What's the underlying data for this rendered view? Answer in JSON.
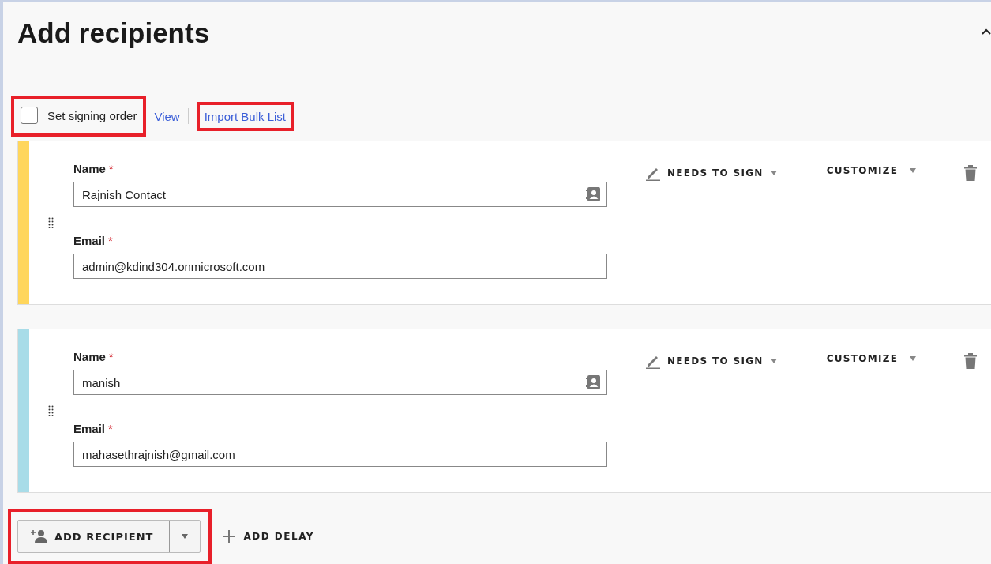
{
  "title": "Add recipients",
  "toolbar": {
    "signing_order": {
      "label": "Set signing order",
      "checked": false,
      "highlighted": true
    },
    "view_link": "View",
    "import_link": {
      "label": "Import Bulk List",
      "highlighted": true
    }
  },
  "recipients": [
    {
      "color": "#ffd65c",
      "name_label": "Name",
      "email_label": "Email",
      "required_mark": "*",
      "name": "Rajnish Contact",
      "email": "admin@kdind304.onmicrosoft.com",
      "role": "NEEDS TO SIGN",
      "customize": "CUSTOMIZE"
    },
    {
      "color": "#a8dce8",
      "name_label": "Name",
      "email_label": "Email",
      "required_mark": "*",
      "name": "manish",
      "email": "mahasethrajnish@gmail.com",
      "role": "NEEDS TO SIGN",
      "customize": "CUSTOMIZE"
    }
  ],
  "add_recipient": {
    "label": "ADD RECIPIENT",
    "highlighted": true
  },
  "add_delay": "ADD DELAY"
}
